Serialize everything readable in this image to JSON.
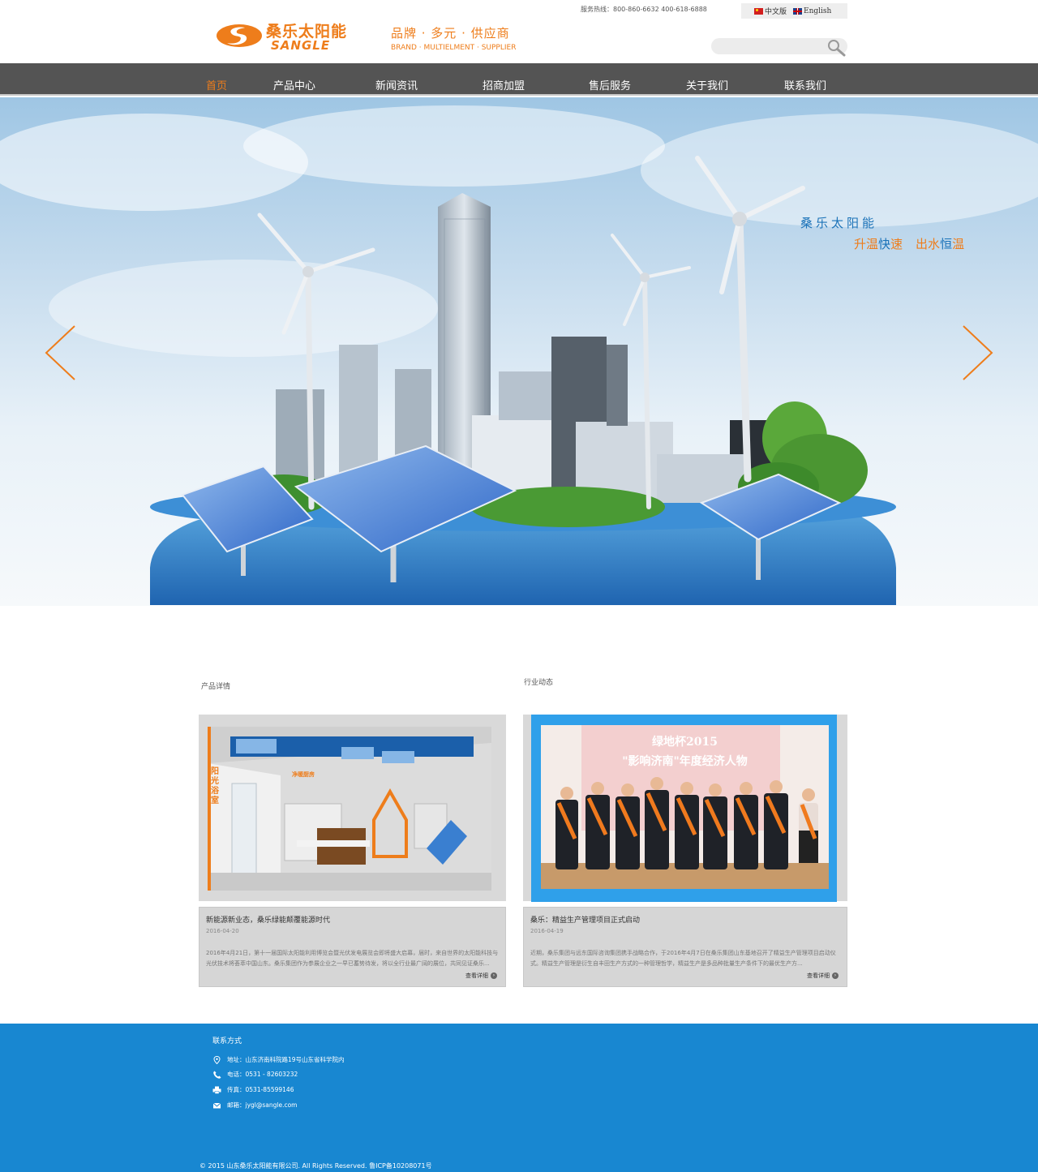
{
  "header": {
    "logo_cn": "桑乐太阳能",
    "logo_en": "SANGLE",
    "slogan_cn": "品牌 · 多元 · 供应商",
    "slogan_en": "BRAND · MULTIELMENT · SUPPLIER",
    "hotline": "服务热线：800-860-6632 400-618-6888",
    "lang_cn": "中文版",
    "lang_en": "English",
    "search_placeholder": ""
  },
  "nav": {
    "items": [
      "首页",
      "产品中心",
      "新闻资讯",
      "招商加盟",
      "售后服务",
      "关于我们",
      "联系我们"
    ],
    "active_index": 0
  },
  "banner": {
    "title": "桑乐太阳能",
    "sub_a1": "升温",
    "sub_a2": "快",
    "sub_a3": "速",
    "sub_b1": "出水",
    "sub_b2": "恒",
    "sub_b3": "温"
  },
  "products": {
    "label": "产品详情",
    "title": "新能源新业态，桑乐绿能颠覆能源时代",
    "date": "2016-04-20",
    "text": "2016年4月21日，第十一届国际太阳能利用博览会暨光伏发电展览会即将盛大启幕，届时，来自世界的太阳能科技与光伏技术将荟萃中国山东。桑乐集团作为参展企业之一早已蓄势待发，将以全行业最广阔的展位，共同见证桑乐...",
    "more": "查看详细",
    "img_sign": "阳光浴室",
    "img_sign2": "净暖厨房"
  },
  "news": {
    "label": "行业动态",
    "title": "桑乐：精益生产管理项目正式启动",
    "date": "2016-04-19",
    "text": "近期，桑乐集团与远东国际咨询集团携手战略合作，于2016年4月7日在桑乐集团山东基地召开了精益生产管理项目启动仪式。精益生产管理是衍生自丰田生产方式的一种管理哲学，精益生产是多品种批量生产条件下的最优生产方...",
    "more": "查看详细",
    "img_line1": "绿地杯2015",
    "img_line2": "\"影响济南\"年度经济人物"
  },
  "footer": {
    "title": "联系方式",
    "address": "地址：山东济南科院路19号山东省科学院内",
    "phone": "电话：0531 - 82603232",
    "fax": "传真：0531-85599146",
    "email": "邮箱：jygl@sangle.com",
    "copyright": "© 2015 山东桑乐太阳能有限公司. All Rights Reserved. 鲁ICP备10208071号"
  },
  "colors": {
    "accent": "#ee7d1b",
    "nav_bg": "#545454",
    "footer_bg": "#1887d1",
    "highlight_border": "#2fa0ea"
  }
}
